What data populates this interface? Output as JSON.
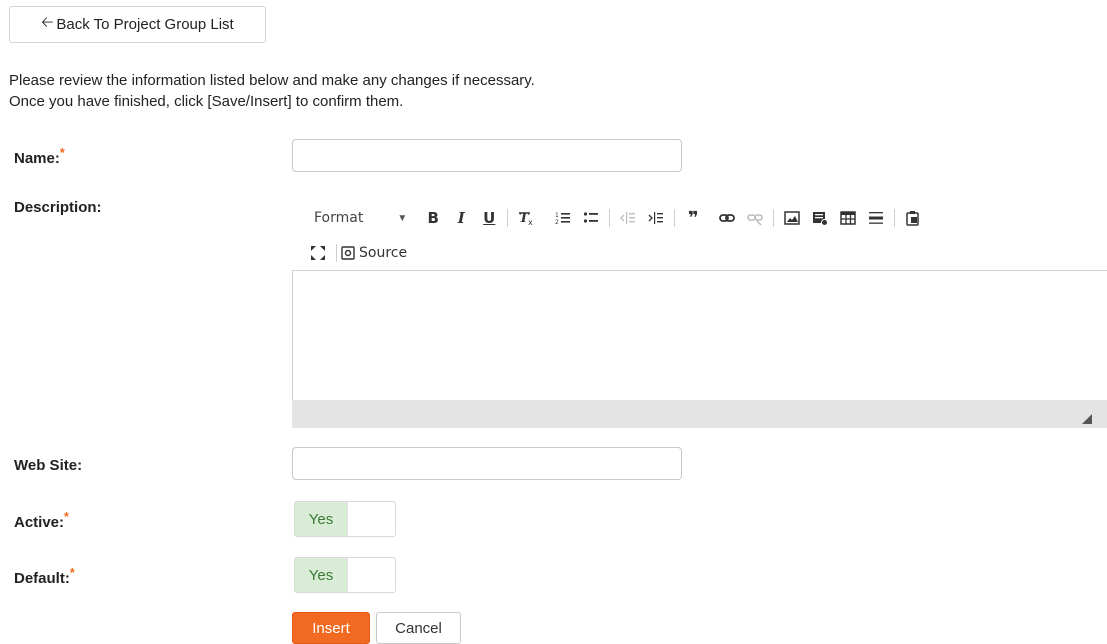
{
  "back_button": {
    "label": "Back To Project Group List"
  },
  "intro": {
    "line1": "Please review the information listed below and make any changes if necessary.",
    "line2": "Once you have finished, click [Save/Insert] to confirm them."
  },
  "fields": {
    "name": {
      "label": "Name:",
      "required": "*",
      "value": ""
    },
    "description": {
      "label": "Description:"
    },
    "website": {
      "label": "Web Site:",
      "value": ""
    },
    "active": {
      "label": "Active:",
      "required": "*",
      "toggle_label": "Yes"
    },
    "default": {
      "label": "Default:",
      "required": "*",
      "toggle_label": "Yes"
    }
  },
  "editor": {
    "format_label": "Format",
    "source_label": "Source",
    "bold_glyph": "B",
    "italic_glyph": "I",
    "underline_glyph": "U",
    "quote_glyph": "❞"
  },
  "actions": {
    "insert": "Insert",
    "cancel": "Cancel"
  },
  "colors": {
    "accent": "#f26a21",
    "toggle_on_bg": "#d9ecd6",
    "required": "#f0681b"
  }
}
